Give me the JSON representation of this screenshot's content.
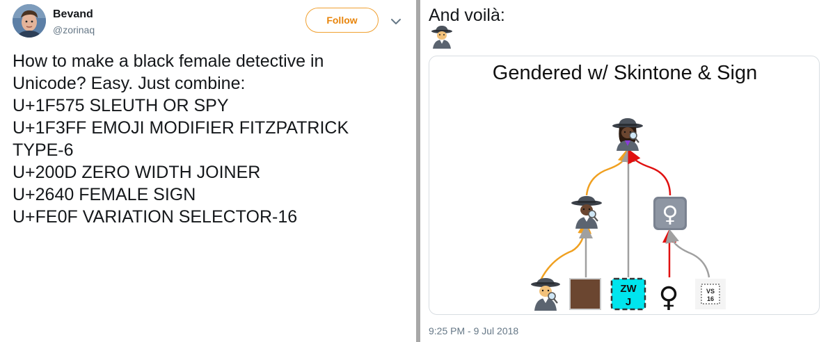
{
  "tweet": {
    "author": {
      "name": "Bevand",
      "handle": "@zorinaq"
    },
    "follow_label": "Follow",
    "lines": [
      "How to make a black female detective in",
      "Unicode? Easy. Just combine:",
      "U+1F575 SLEUTH OR SPY",
      "U+1F3FF EMOJI MODIFIER FITZPATRICK",
      "TYPE-6",
      "U+200D ZERO WIDTH JOINER",
      "U+2640 FEMALE SIGN",
      "U+FE0F VARIATION SELECTOR-16"
    ]
  },
  "reply": {
    "text": "And voilà:",
    "emoji_icon": "detective-icon",
    "timestamp": "9:25 PM - 9 Jul 2018",
    "card": {
      "title": "Gendered w/ Skintone & Sign",
      "nodes": {
        "zwj_label_top": "ZW",
        "zwj_label_bottom": "J",
        "vs_label_top": "VS",
        "vs_label_bottom": "16",
        "female_sign": "♀"
      },
      "colors": {
        "orange_arrow": "#f0a020",
        "gray_arrow": "#a0a0a0",
        "red_arrow": "#e01010",
        "zwj_fill": "#00e5ee",
        "skin_swatch": "#6b4630",
        "sign_box": "#7a8290"
      }
    }
  }
}
